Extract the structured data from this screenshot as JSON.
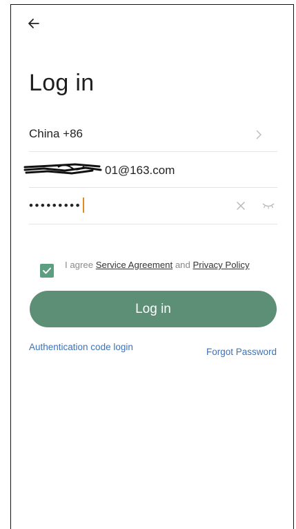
{
  "header": {
    "back_icon": "arrow-left-icon",
    "title": "Log in"
  },
  "form": {
    "country": {
      "value": "China +86",
      "chevron_icon": "chevron-right-icon"
    },
    "email": {
      "visible_suffix": "01@163.com"
    },
    "password": {
      "masked_value": "•••••••••",
      "clear_icon": "close-icon",
      "toggle_icon": "eye-closed-icon"
    }
  },
  "agreement": {
    "checked": true,
    "prefix": "I agree ",
    "service_link": "Service Agreement",
    "conjunction": " and ",
    "privacy_link": "Privacy Policy"
  },
  "actions": {
    "login_label": "Log in",
    "auth_code_label": "Authentication code login",
    "forgot_label": "Forgot Password"
  },
  "colors": {
    "accent": "#5c8f76",
    "checkbox": "#5c9f80",
    "link": "#3a72b9",
    "caret": "#e08a1f"
  }
}
